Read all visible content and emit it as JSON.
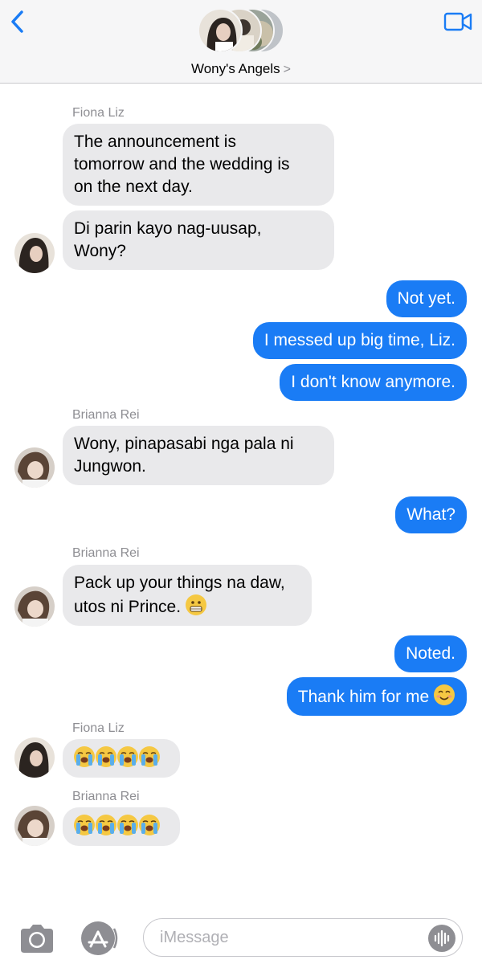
{
  "header": {
    "group_name": "Wony's Angels",
    "chevron": ">"
  },
  "messages": [
    {
      "sender": "Fiona Liz",
      "text_lines": [
        "The announcement is",
        "tomorrow and the wedding is",
        "on the next day."
      ]
    },
    {
      "text_lines": [
        "Di parin kayo nag-uusap,",
        "Wony?"
      ]
    },
    {
      "text": "Not yet."
    },
    {
      "text": "I messed up big time, Liz."
    },
    {
      "text": "I don't know anymore."
    },
    {
      "sender": "Brianna Rei",
      "text_lines": [
        "Wony, pinapasabi nga pala ni",
        "Jungwon."
      ]
    },
    {
      "text": "What?"
    },
    {
      "sender": "Brianna Rei",
      "text_lines": [
        "Pack up your things na daw,",
        "utos ni Prince."
      ],
      "emoji": "grimacing-face"
    },
    {
      "text": "Noted."
    },
    {
      "text": "Thank him for me",
      "emoji": "smiling-face"
    },
    {
      "sender": "Fiona Liz",
      "emojis": [
        "loudly-crying-face",
        "loudly-crying-face",
        "loudly-crying-face",
        "loudly-crying-face"
      ]
    },
    {
      "sender": "Brianna Rei",
      "emojis": [
        "loudly-crying-face",
        "loudly-crying-face",
        "loudly-crying-face",
        "loudly-crying-face"
      ]
    }
  ],
  "input": {
    "placeholder": "iMessage"
  },
  "colors": {
    "outgoing_bubble": "#1a7cf5",
    "incoming_bubble": "#e9e9eb",
    "accent": "#1a7cf5"
  }
}
